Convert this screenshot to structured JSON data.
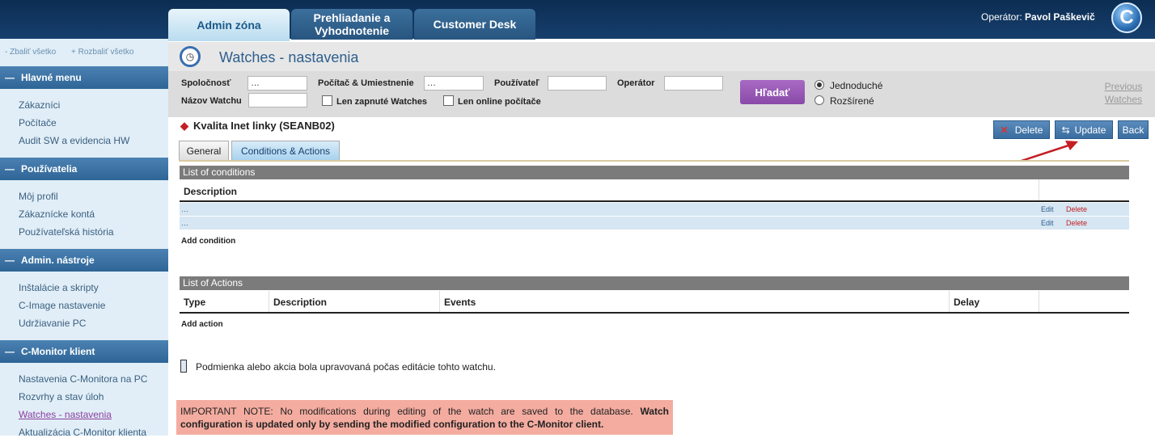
{
  "header": {
    "tabs": [
      {
        "label": "Admin zóna",
        "active": true
      },
      {
        "label": "Prehliadanie a Vyhodnotenie",
        "active": false
      },
      {
        "label": "Customer Desk",
        "active": false
      }
    ],
    "operator_label": "Operátor:",
    "operator_name": "Pavol Paškevič",
    "logo_letter": "C"
  },
  "sidebar": {
    "collapse_all": "- Zbaliť všetko",
    "expand_all": "+ Rozbaliť všetko",
    "sections": [
      {
        "title": "Hlavné menu",
        "items": [
          "Zákazníci",
          "Počítače",
          "Audit SW a evidencia HW"
        ]
      },
      {
        "title": "Používatelia",
        "items": [
          "Môj profil",
          "Zákaznícke kontá",
          "Používateľská história"
        ]
      },
      {
        "title": "Admin. nástroje",
        "items": [
          "Inštalácie a skripty",
          "C-Image nastavenie",
          "Udržiavanie PC"
        ]
      },
      {
        "title": "C-Monitor klient",
        "items": [
          "Nastavenia C-Monitora na PC",
          "Rozvrhy a stav úloh",
          "Watches - nastavenia",
          "Aktualizácia C-Monitor klienta"
        ]
      }
    ],
    "current_item": "Watches - nastavenia"
  },
  "page": {
    "title": "Watches - nastavenia"
  },
  "filters": {
    "company_label": "Spoločnosť",
    "company_value": "…",
    "computer_label": "Počítač & Umiestnenie",
    "computer_value": "…",
    "user_label": "Používateľ",
    "user_value": "",
    "operator_label": "Operátor",
    "operator_value": "",
    "watch_name_label": "Názov Watchu",
    "watch_name_value": "",
    "only_enabled_label": "Len zapnuté Watches",
    "only_online_label": "Len online počítače",
    "search_button": "Hľadať",
    "mode_simple": "Jednoduché",
    "mode_advanced": "Rozšírené",
    "previous_watches": "Previous Watches"
  },
  "watch": {
    "title": "Kvalita Inet linky (SEANB02)",
    "delete_button": "Delete",
    "update_button": "Update",
    "back_button": "Back",
    "tabs": [
      "General",
      "Conditions & Actions"
    ],
    "active_tab": "Conditions & Actions"
  },
  "conditions": {
    "heading": "List of conditions",
    "column_description": "Description",
    "rows": [
      {
        "text": "…",
        "edit": "Edit",
        "delete": "Delete"
      },
      {
        "text": "…",
        "edit": "Edit",
        "delete": "Delete"
      }
    ],
    "add_link": "Add condition"
  },
  "actions": {
    "heading": "List of Actions",
    "columns": [
      "Type",
      "Description",
      "Events",
      "Delay"
    ],
    "add_link": "Add action"
  },
  "legend": "Podmienka alebo akcia bola upravovaná počas editácie tohto watchu.",
  "note": {
    "normal": "IMPORTANT NOTE: No modifications during editing of the watch are saved to the database.",
    "bold": "Watch configuration is updated only by sending the modified configuration to the C-Monitor client."
  },
  "colors": {
    "accent": "#2d5f8e",
    "search_button": "#8a4aa8",
    "note_bg": "#f4aca0",
    "delete_red": "#c31f24"
  }
}
